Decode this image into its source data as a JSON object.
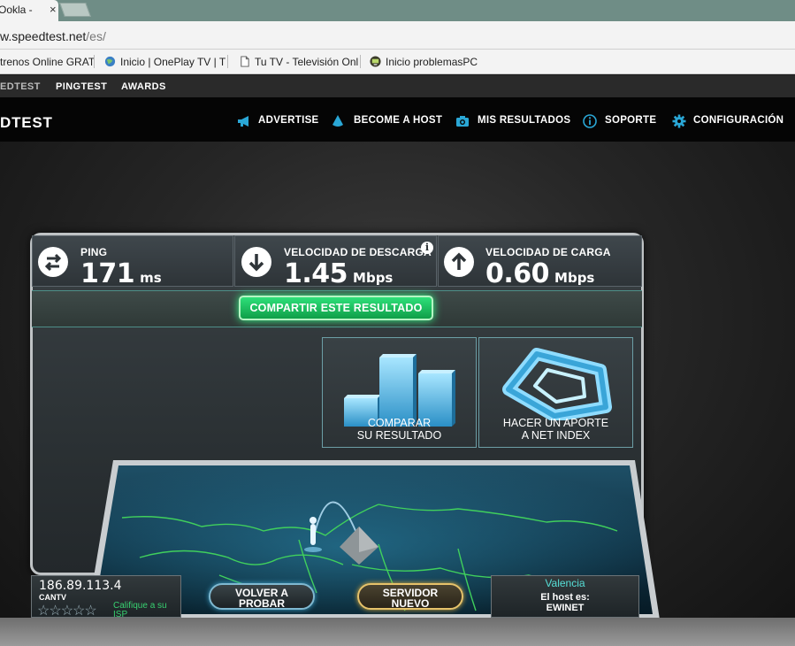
{
  "browser": {
    "tab_title": "Ookla -",
    "tab_close": "×",
    "url_domain": "w.speedtest.net",
    "url_path": "/es/",
    "bookmarks": [
      {
        "label": "trenos Online GRAT",
        "icon": "page-icon"
      },
      {
        "label": "Inicio | OnePlay TV | T",
        "icon": "globe-icon"
      },
      {
        "label": "Tu TV - Televisión Onl",
        "icon": "document-icon"
      },
      {
        "label": "Inicio problemasPC",
        "icon": "pc-icon"
      }
    ]
  },
  "site": {
    "ookla_links": [
      "EDTEST",
      "PINGTEST",
      "AWARDS"
    ],
    "logo": "DTEST",
    "nav": [
      {
        "label": "ADVERTISE",
        "icon": "megaphone-icon"
      },
      {
        "label": "BECOME A HOST",
        "icon": "drop-icon"
      },
      {
        "label": "MIS RESULTADOS",
        "icon": "camera-icon"
      },
      {
        "label": "SOPORTE",
        "icon": "info-circle-icon"
      },
      {
        "label": "CONFIGURACIÓN",
        "icon": "gear-icon"
      }
    ],
    "accent_color": "#2aa7d6"
  },
  "results": {
    "ping": {
      "label": "PING",
      "value": "171",
      "unit": "ms",
      "icon": "ping-arrows-icon"
    },
    "download": {
      "label": "VELOCIDAD DE DESCARGA",
      "value": "1.45",
      "unit": "Mbps",
      "icon": "arrow-down-icon",
      "info": "i"
    },
    "upload": {
      "label": "VELOCIDAD DE CARGA",
      "value": "0.60",
      "unit": "Mbps",
      "icon": "arrow-up-icon"
    },
    "share_label": "COMPARTIR ESTE RESULTADO"
  },
  "tiles": {
    "compare": {
      "line1": "COMPARAR",
      "line2": "SU RESULTADO"
    },
    "netindex": {
      "line1": "HACER UN APORTE",
      "line2": "A NET INDEX"
    }
  },
  "footer": {
    "ip": "186.89.113.4",
    "isp": "CANTV",
    "stars": "☆☆☆☆☆",
    "rate_isp": "Califique a su ISP",
    "retest": {
      "line1": "VOLVER A",
      "line2": "PROBAR"
    },
    "new_server": {
      "line1": "SERVIDOR",
      "line2": "NUEVO"
    },
    "server_city": "Valencia",
    "host_label": "El host es:",
    "host_name": "EWINET"
  }
}
